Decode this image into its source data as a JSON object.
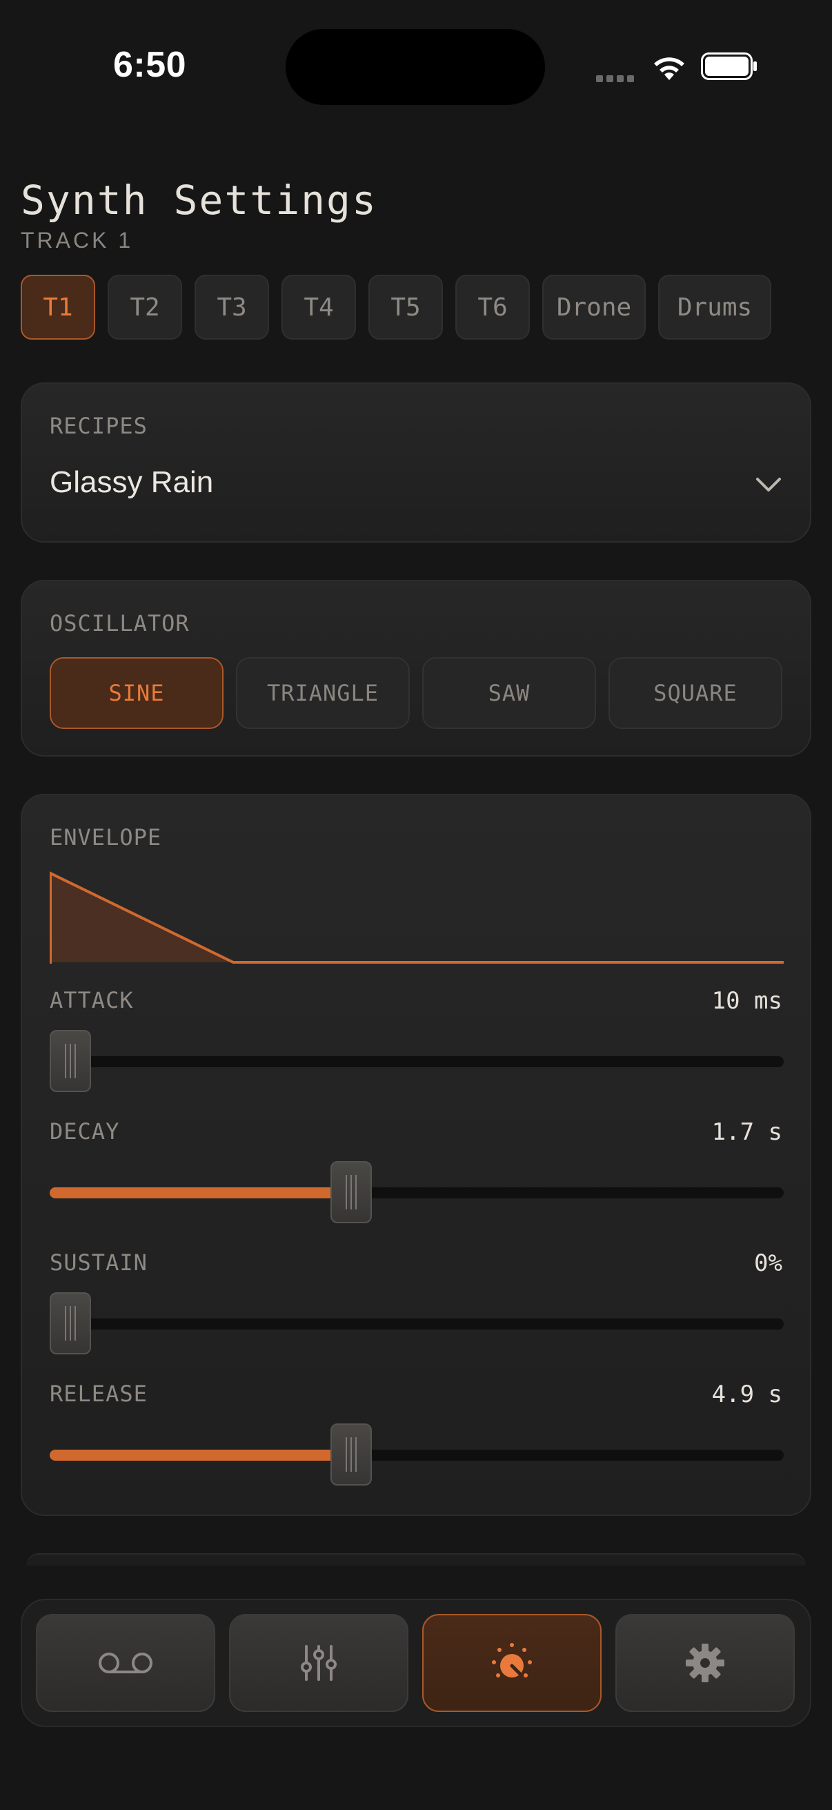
{
  "status": {
    "time": "6:50",
    "icons": [
      "cellular-signal-icon",
      "wifi-icon",
      "battery-icon"
    ]
  },
  "header": {
    "title": "Synth Settings",
    "subtitle": "TRACK 1"
  },
  "tracks": {
    "items": [
      "T1",
      "T2",
      "T3",
      "T4",
      "T5",
      "T6",
      "Drone",
      "Drums"
    ],
    "selected": "T1"
  },
  "recipes": {
    "label": "RECIPES",
    "value": "Glassy Rain",
    "icon": "chevron-down-icon"
  },
  "oscillator": {
    "label": "OSCILLATOR",
    "options": [
      "SINE",
      "TRIANGLE",
      "SAW",
      "SQUARE"
    ],
    "selected": "SINE"
  },
  "envelope": {
    "label": "ENVELOPE",
    "params": [
      {
        "label": "ATTACK",
        "value": "10 ms",
        "level": 0.0
      },
      {
        "label": "DECAY",
        "value": "1.7 s",
        "level": 0.405
      },
      {
        "label": "SUSTAIN",
        "value": "0%",
        "level": 0.0
      },
      {
        "label": "RELEASE",
        "value": "4.9 s",
        "level": 0.405
      }
    ]
  },
  "nav": {
    "items": [
      {
        "icon": "voicemail-tape-icon"
      },
      {
        "icon": "mixer-sliders-icon"
      },
      {
        "icon": "synth-knob-icon",
        "active": true
      },
      {
        "icon": "gear-icon"
      }
    ]
  },
  "colors": {
    "accent": "#e97a3b",
    "accent_fill": "#d1692f",
    "background": "#161616",
    "card": "#242424"
  }
}
